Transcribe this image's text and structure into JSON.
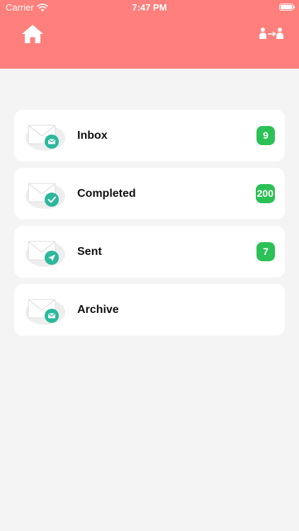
{
  "status_bar": {
    "carrier": "Carrier",
    "time": "7:47 PM"
  },
  "header": {
    "left_icon": "home-icon",
    "right_icon": "swap-users-icon",
    "background": "#fe7f7b"
  },
  "mailboxes": [
    {
      "label": "Inbox",
      "count": "9",
      "icon": "envelope-mail-icon"
    },
    {
      "label": "Completed",
      "count": "200",
      "icon": "envelope-check-icon"
    },
    {
      "label": "Sent",
      "count": "7",
      "icon": "envelope-send-icon"
    },
    {
      "label": "Archive",
      "count": "",
      "icon": "envelope-archive-icon"
    }
  ],
  "colors": {
    "badge": "#2bc156",
    "icon_accent": "#2cb89d"
  }
}
